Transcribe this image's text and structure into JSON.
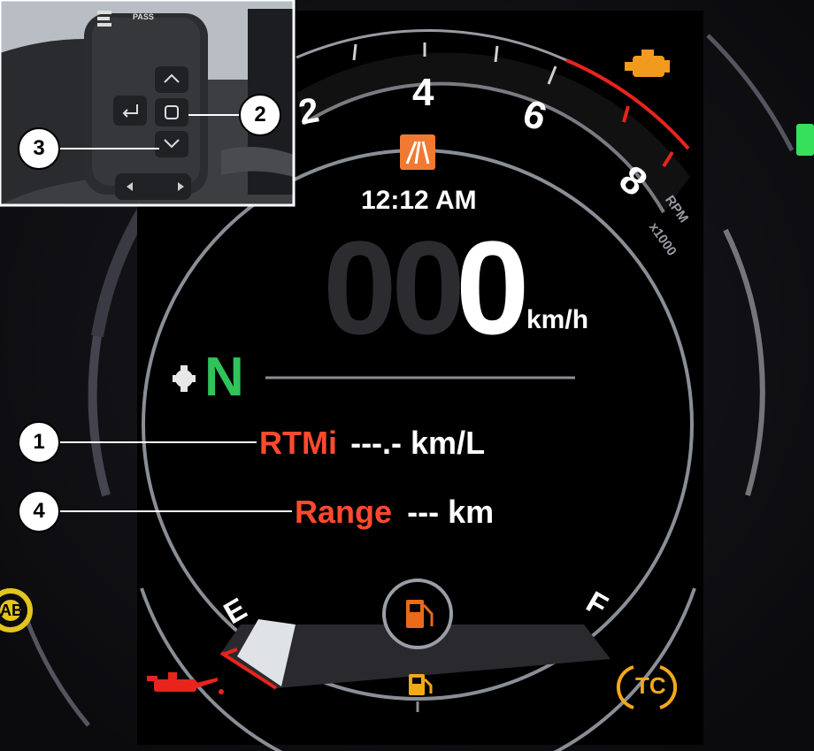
{
  "dashboard": {
    "tach": {
      "ticks": [
        "2",
        "4",
        "6",
        "8"
      ],
      "unit_line1": "RPM",
      "unit_line2": "x1000",
      "redline_color": "#e8241c"
    },
    "clock": "12:12 AM",
    "speed": {
      "dim_digits": "00",
      "value": "0",
      "unit": "km/h"
    },
    "gear": "N",
    "gear_color": "#2ec45a",
    "info_rows": [
      {
        "label": "RTMi",
        "value": "---.- km/L"
      },
      {
        "label": "Range",
        "value": "--- km"
      }
    ],
    "label_color": "#ff4a2e",
    "fuel": {
      "empty_label": "E",
      "full_label": "F",
      "level_fraction": 0.14
    },
    "warning_icons": [
      "engine-check-icon",
      "road-slippery-icon",
      "oil-pressure-icon",
      "fuel-reserve-icon",
      "traction-control-icon",
      "abs-icon",
      "neutral-green-lamp"
    ],
    "tc_label": "TC",
    "abs_label": "ABS"
  },
  "inset": {
    "switch_label": "PASS",
    "callouts": [
      "1",
      "2",
      "3",
      "4"
    ]
  }
}
